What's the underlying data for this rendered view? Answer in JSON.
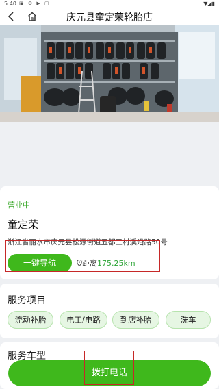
{
  "status_bar": {
    "time": "5:40",
    "icons": [
      "a",
      "settings",
      "play",
      "sim"
    ]
  },
  "header": {
    "title": "庆元县童定荣轮胎店"
  },
  "shop": {
    "status": "营业中",
    "name": "童定荣",
    "address": "浙江省丽水市庆元县松源街道五都三村溪沿路50号",
    "navigate_label": "一键导航",
    "distance_prefix": "距离",
    "distance_value": "175.25km"
  },
  "services": {
    "title": "服务项目",
    "items": [
      "流动补胎",
      "电工/电路",
      "到店补胎",
      "洗车"
    ]
  },
  "vehicles": {
    "title": "服务车型"
  },
  "call_button": "拨打电话",
  "colors": {
    "accent": "#3fb81c",
    "highlight_box": "#c62828",
    "chip_bg": "#e6f6e3"
  }
}
